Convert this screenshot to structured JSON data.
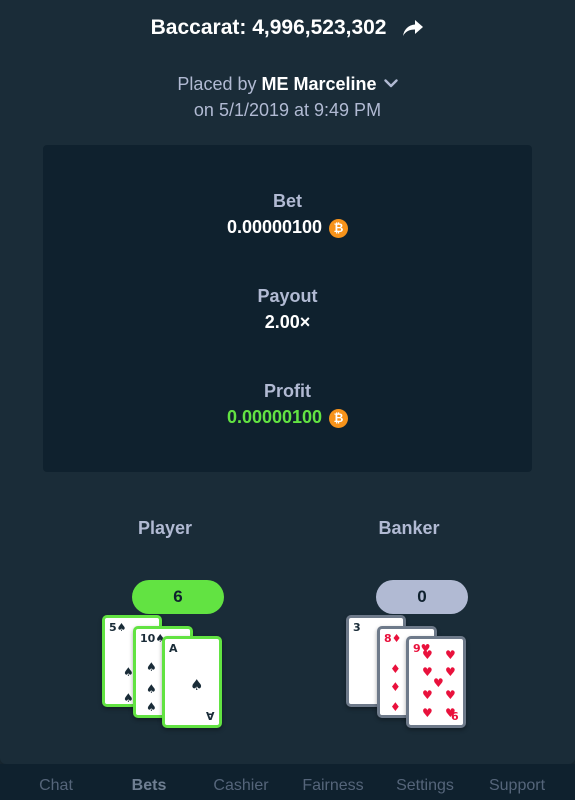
{
  "modal": {
    "title": "Baccarat: 4,996,523,302",
    "placed_prefix": "Placed by",
    "user_name": "ME Marceline",
    "date": "on 5/1/2019 at 9:49 PM"
  },
  "stats": {
    "bet_label": "Bet",
    "bet_value": "0.00000100",
    "payout_label": "Payout",
    "payout_value": "2.00×",
    "profit_label": "Profit",
    "profit_value": "0.00000100",
    "currency_symbol": "₿"
  },
  "hands": {
    "player": {
      "label": "Player",
      "score": "6",
      "cards": [
        {
          "rank": "5",
          "suit": "♠",
          "color": "black"
        },
        {
          "rank": "10",
          "suit": "♠",
          "color": "black"
        },
        {
          "rank": "A",
          "suit": "♠",
          "color": "black"
        }
      ]
    },
    "banker": {
      "label": "Banker",
      "score": "0",
      "cards": [
        {
          "rank": "3",
          "suit": "♠",
          "color": "black"
        },
        {
          "rank": "8",
          "suit": "♦",
          "color": "red"
        },
        {
          "rank": "9",
          "suit": "♥",
          "color": "red"
        }
      ]
    }
  },
  "nav": {
    "items": [
      "Chat",
      "Bets",
      "Cashier",
      "Fairness",
      "Settings",
      "Support"
    ],
    "active": "Bets"
  },
  "colors": {
    "accent_green": "#62e342",
    "btc_orange": "#f7931a",
    "panel": "#0f212e",
    "modal": "#1a2c38",
    "muted_text": "#b1bad3"
  },
  "icons": {
    "share": "share-arrow-icon",
    "dropdown": "chevron-down-icon",
    "currency": "bitcoin-icon"
  }
}
